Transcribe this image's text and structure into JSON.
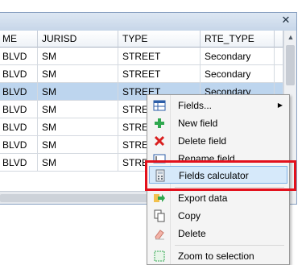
{
  "window": {
    "close_glyph": "✕"
  },
  "table": {
    "columns": [
      "ME",
      "JURISD",
      "TYPE",
      "RTE_TYPE"
    ],
    "rows": [
      [
        "BLVD",
        "SM",
        "STREET",
        "Secondary"
      ],
      [
        "BLVD",
        "SM",
        "STREET",
        "Secondary"
      ],
      [
        "BLVD",
        "SM",
        "STREET",
        "Secondary"
      ],
      [
        "BLVD",
        "SM",
        "STREET",
        ""
      ],
      [
        "BLVD",
        "SM",
        "STREET",
        ""
      ],
      [
        "BLVD",
        "SM",
        "STREET",
        ""
      ],
      [
        "BLVD",
        "SM",
        "STREET",
        ""
      ]
    ],
    "selected_row": 2
  },
  "context_menu": {
    "items": [
      {
        "label": "Fields...",
        "icon": "fields-table-icon",
        "has_submenu": true
      },
      {
        "label": "New field",
        "icon": "plus-icon"
      },
      {
        "label": "Delete field",
        "icon": "red-x-icon"
      },
      {
        "label": "Rename field",
        "icon": "rename-field-icon"
      },
      {
        "label": "Fields calculator",
        "icon": "calculator-icon",
        "highlighted": true
      },
      {
        "label": "Export data",
        "icon": "export-arrow-icon"
      },
      {
        "label": "Copy",
        "icon": "copy-icon"
      },
      {
        "label": "Delete",
        "icon": "eraser-icon"
      },
      {
        "label": "Zoom to selection",
        "icon": "zoom-selection-icon"
      }
    ]
  },
  "colors": {
    "selection_row": "#bdd5ee",
    "menu_highlight": "#d6e9fa",
    "annotation_frame": "#e3101c"
  }
}
